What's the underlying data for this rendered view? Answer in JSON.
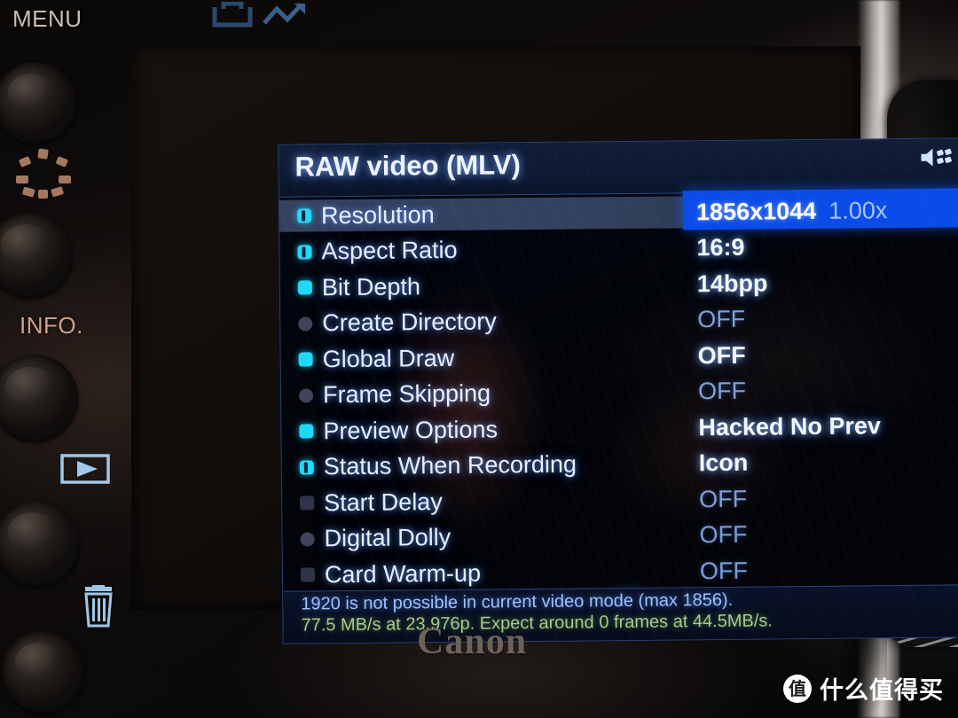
{
  "camera": {
    "brand_logo": "Canon",
    "controls": {
      "menu_label": "MENU",
      "info_label": "INFO.",
      "icons": {
        "picture_style": "picture-style-icon",
        "brightness": "brightness-sun-icon",
        "playback": "playback-icon",
        "trash": "trash-icon"
      }
    }
  },
  "screen": {
    "title": "RAW video (MLV)",
    "audio_icon": "speaker-audio-icon",
    "scroll_indicator": "chevron-down-icon",
    "items": [
      {
        "label": "Resolution",
        "value": "1856x1044",
        "value_suffix": "1.00x",
        "bullet": "sq-half",
        "state": "bright",
        "selected": true
      },
      {
        "label": "Aspect Ratio",
        "value": "16:9",
        "bullet": "sq-half",
        "state": "bright",
        "selected": false
      },
      {
        "label": "Bit Depth",
        "value": "14bpp",
        "bullet": "sq-on",
        "state": "bright",
        "selected": false
      },
      {
        "label": "Create Directory",
        "value": "OFF",
        "bullet": "dot-off",
        "state": "dim",
        "selected": false
      },
      {
        "label": "Global Draw",
        "value": "OFF",
        "bullet": "sq-on",
        "state": "bright",
        "selected": false
      },
      {
        "label": "Frame Skipping",
        "value": "OFF",
        "bullet": "dot-off",
        "state": "dim",
        "selected": false
      },
      {
        "label": "Preview Options",
        "value": "Hacked No Prev",
        "bullet": "sq-on",
        "state": "bright",
        "selected": false
      },
      {
        "label": "Status When Recording",
        "value": "Icon",
        "bullet": "sq-half",
        "state": "bright",
        "selected": false
      },
      {
        "label": "Start Delay",
        "value": "OFF",
        "bullet": "sq-off",
        "state": "dim",
        "selected": false
      },
      {
        "label": "Digital Dolly",
        "value": "OFF",
        "bullet": "dot-off",
        "state": "dim",
        "selected": false
      },
      {
        "label": "Card Warm-up",
        "value": "OFF",
        "bullet": "sq-off",
        "state": "dim",
        "selected": false
      }
    ],
    "help": {
      "line1": "1920 is not possible in current video mode (max 1856).",
      "line2": "77.5 MB/s at 23.976p. Expect around 0 frames at 44.5MB/s."
    }
  },
  "watermark": {
    "badge": "值",
    "text": "什么值得买"
  },
  "colors": {
    "selection_blue": "#0b4ce8",
    "bullet_cyan": "#22d8f8",
    "title_bar": "#0e1a33",
    "help_green": "#a9c98c",
    "help_blue": "#9fc0f8"
  }
}
